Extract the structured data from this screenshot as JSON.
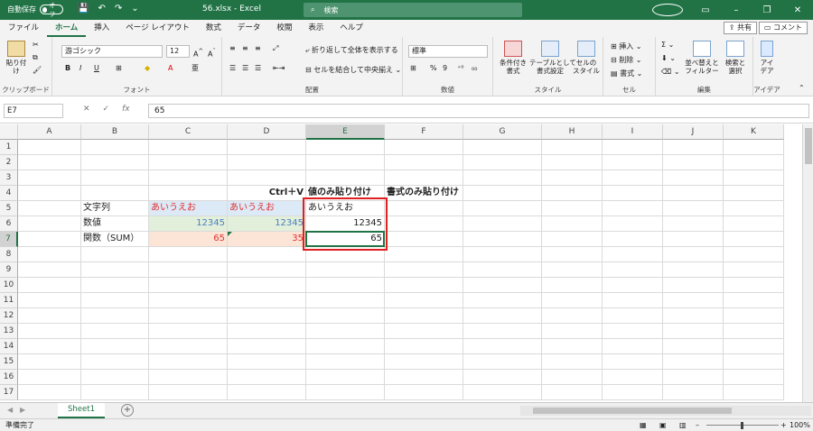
{
  "titlebar": {
    "autosave_label": "自動保存",
    "autosave_state": "オフ",
    "doc_title": "56.xlsx  -  Excel",
    "search_placeholder": "検索"
  },
  "tabs": [
    "ファイル",
    "ホーム",
    "挿入",
    "ページ レイアウト",
    "数式",
    "データ",
    "校閲",
    "表示",
    "ヘルプ"
  ],
  "active_tab": "ホーム",
  "share_label": "共有",
  "comment_label": "コメント",
  "ribbon": {
    "clipboard": {
      "paste": "貼り付け",
      "label": "クリップボード"
    },
    "font": {
      "name": "游ゴシック",
      "size": "12",
      "label": "フォント"
    },
    "alignment": {
      "wrap": "折り返して全体を表示する",
      "merge": "セルを結合して中央揃え",
      "label": "配置"
    },
    "number": {
      "format": "標準",
      "label": "数値"
    },
    "styles": {
      "conditional": "条件付き\n書式",
      "table": "テーブルとして\n書式設定",
      "cell": "セルの\nスタイル",
      "label": "スタイル"
    },
    "cells": {
      "insert": "挿入",
      "delete": "削除",
      "format": "書式",
      "label": "セル"
    },
    "editing": {
      "sort": "並べ替えと\nフィルター",
      "find": "検索と\n選択",
      "label": "編集"
    },
    "ideas": {
      "label_btn": "アイ\nデア",
      "label": "アイデア"
    }
  },
  "formula_bar": {
    "name_box": "E7",
    "formula": "65"
  },
  "columns": [
    "A",
    "B",
    "C",
    "D",
    "E",
    "F",
    "G",
    "H",
    "I",
    "J",
    "K"
  ],
  "rows": [
    "1",
    "2",
    "3",
    "4",
    "5",
    "6",
    "7",
    "8",
    "9",
    "10",
    "11",
    "12",
    "13",
    "14",
    "15",
    "16",
    "17"
  ],
  "cells": {
    "D4": "Ctrl＋V",
    "E4": "値のみ貼り付け",
    "F4": "書式のみ貼り付け",
    "B5": "文字列",
    "C5": "あいうえお",
    "D5": "あいうえお",
    "E5": "あいうえお",
    "B6": "数値",
    "C6": "12345",
    "D6": "12345",
    "E6": "12345",
    "B7": "関数（SUM）",
    "C7": "65",
    "D7": "35",
    "E7": "65"
  },
  "colors": {
    "accent": "#217346",
    "red_text": "#e03030",
    "blue_text": "#4a7fc1",
    "fill_blue": "#dce9f6",
    "fill_green": "#e2efda",
    "fill_orange": "#fce4d6",
    "highlight_box": "#e02020"
  },
  "sheet_tab": "Sheet1",
  "status": {
    "ready": "準備完了",
    "zoom": "100%"
  }
}
